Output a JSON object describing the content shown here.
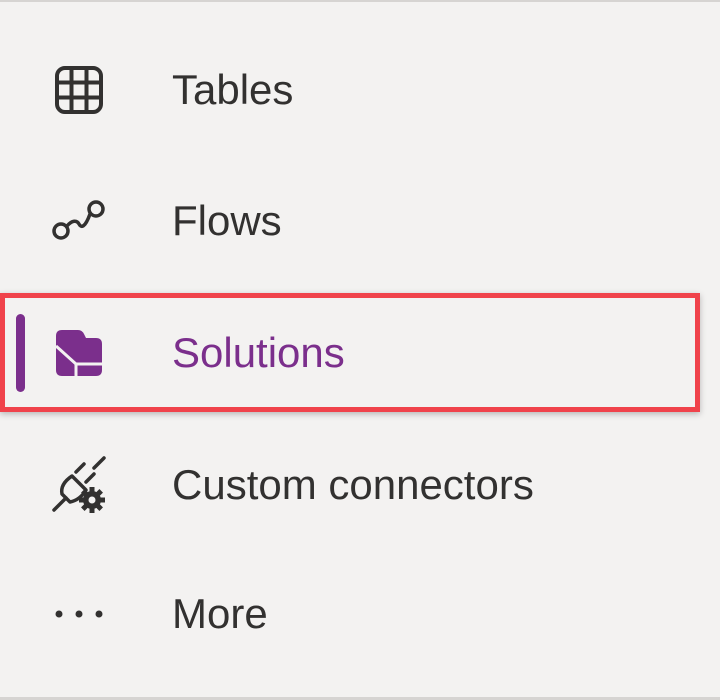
{
  "nav": {
    "items": [
      {
        "label": "Tables",
        "icon": "table-grid-icon",
        "selected": false
      },
      {
        "label": "Flows",
        "icon": "flow-icon",
        "selected": false
      },
      {
        "label": "Solutions",
        "icon": "solutions-icon",
        "selected": true
      },
      {
        "label": "Custom connectors",
        "icon": "custom-connector-icon",
        "selected": false
      },
      {
        "label": "More",
        "icon": "more-icon",
        "selected": false
      }
    ]
  },
  "colors": {
    "background": "#f3f2f1",
    "text": "#323130",
    "selected_accent": "#7b2f8c",
    "highlight_border": "#f0434b"
  }
}
